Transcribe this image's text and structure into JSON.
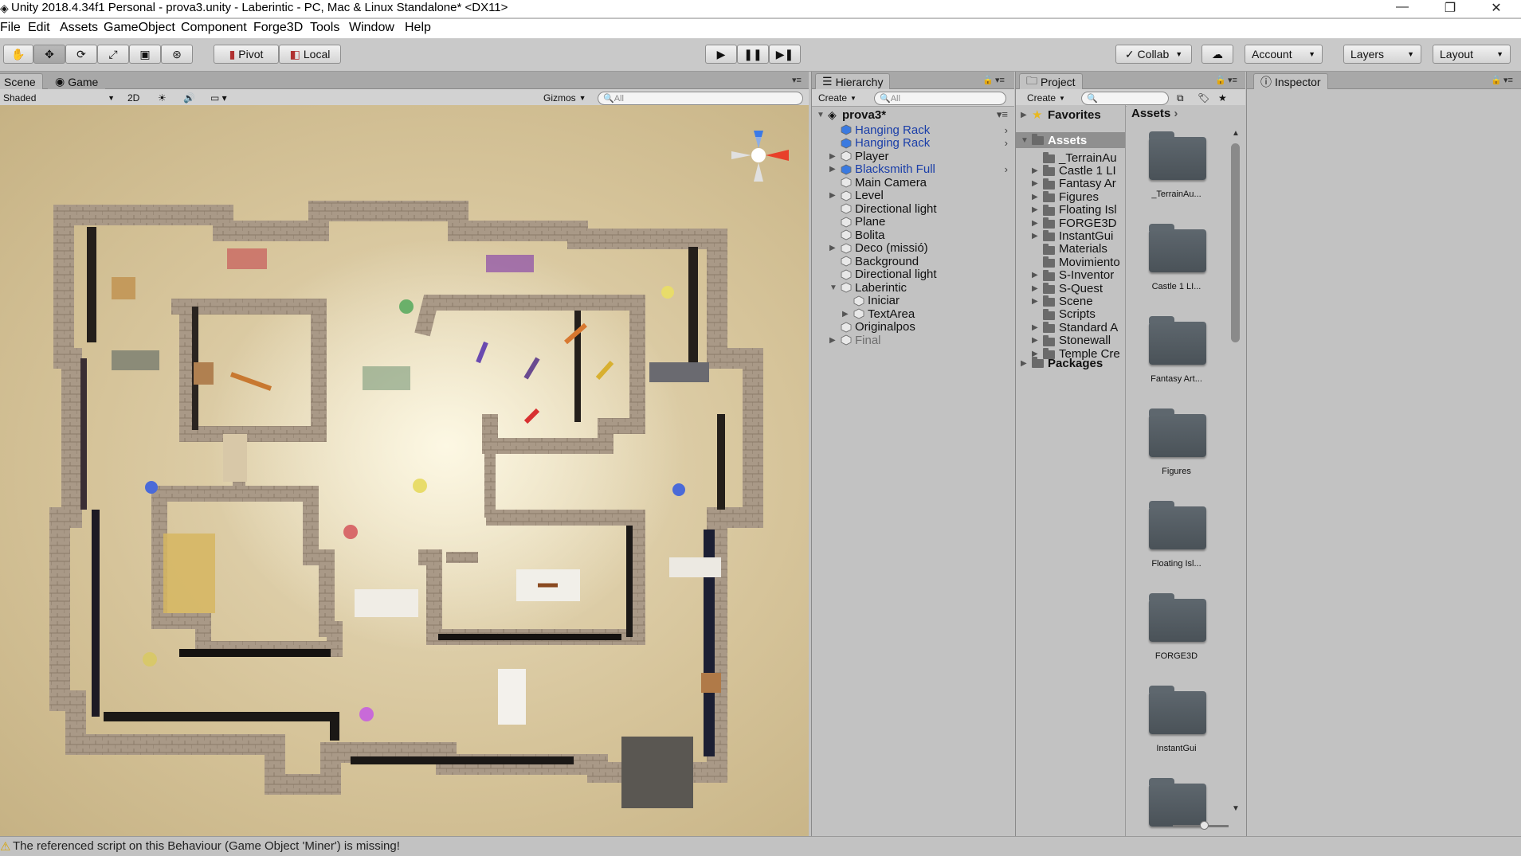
{
  "window": {
    "title": "Unity 2018.4.34f1 Personal - prova3.unity - Laberintic - PC, Mac & Linux Standalone* <DX11>",
    "minimize": "—",
    "maximize": "❐",
    "close": "✕"
  },
  "menu": [
    "File",
    "Edit",
    "Assets",
    "GameObject",
    "Component",
    "Forge3D",
    "Tools",
    "Window",
    "Help"
  ],
  "toolbar": {
    "pivot_label": "Pivot",
    "local_label": "Local",
    "collab_label": "Collab",
    "account_label": "Account",
    "layers_label": "Layers",
    "layout_label": "Layout"
  },
  "scene": {
    "tab_scene": "Scene",
    "tab_game": "Game",
    "shading_mode": "Shaded",
    "mode_2d": "2D",
    "gizmos_label": "Gizmos",
    "search_placeholder": "All"
  },
  "hierarchy": {
    "tab_label": "Hierarchy",
    "create_label": "Create",
    "search_placeholder": "All",
    "scene_name": "prova3*",
    "items": [
      {
        "label": "Hanging Rack",
        "color": "#1a3ea8"
      },
      {
        "label": "Hanging Rack",
        "color": "#1a3ea8"
      },
      {
        "label": "Player",
        "color": "#111111"
      },
      {
        "label": "Blacksmith Full",
        "color": "#1a3ea8"
      },
      {
        "label": "Main Camera",
        "color": "#111111"
      },
      {
        "label": "Level",
        "color": "#111111"
      },
      {
        "label": "Directional light",
        "color": "#111111"
      },
      {
        "label": "Plane",
        "color": "#111111"
      },
      {
        "label": "Bolita",
        "color": "#111111"
      },
      {
        "label": "Deco (missió)",
        "color": "#111111"
      },
      {
        "label": "Background",
        "color": "#111111"
      },
      {
        "label": "Directional light",
        "color": "#111111"
      },
      {
        "label": "Laberintic",
        "color": "#111111"
      },
      {
        "label": "Iniciar",
        "color": "#111111"
      },
      {
        "label": "TextArea",
        "color": "#111111"
      },
      {
        "label": "Originalpos",
        "color": "#111111"
      },
      {
        "label": "Final",
        "color": "#6f6f6f"
      }
    ]
  },
  "project": {
    "tab_label": "Project",
    "create_label": "Create",
    "favorites_label": "Favorites",
    "assets_label": "Assets",
    "breadcrumb": "Assets",
    "packages_label": "Packages",
    "tree": [
      "_TerrainAu",
      "Castle 1 LI",
      "Fantasy Ar",
      "Figures",
      "Floating Isl",
      "FORGE3D",
      "InstantGui",
      "Materials",
      "Movimiento",
      "S-Inventor",
      "S-Quest",
      "Scene",
      "Scripts",
      "Standard A",
      "Stonewall",
      "Temple Cre"
    ],
    "grid": [
      "_TerrainAu...",
      "Castle 1 LI...",
      "Fantasy Art...",
      "Figures",
      "Floating Isl...",
      "FORGE3D",
      "InstantGui"
    ]
  },
  "inspector": {
    "tab_label": "Inspector"
  },
  "status": {
    "message": "The referenced script on this Behaviour (Game Object 'Miner') is missing!"
  },
  "colors": {
    "selected_blue": "#1a3ea8",
    "warning": "#d8a400",
    "panel_bg": "#c2c2c2",
    "assets_highlight": "#8f8f8f"
  },
  "icons": {
    "hand": "hand-tool-icon",
    "move": "move-tool-icon",
    "rotate": "rotate-tool-icon",
    "scale": "scale-tool-icon",
    "rect": "rect-tool-icon",
    "transform": "transform-tool-icon",
    "play": "play-icon",
    "pause": "pause-icon",
    "step": "step-icon",
    "cloud": "cloud-icon",
    "warning": "warning-icon"
  }
}
